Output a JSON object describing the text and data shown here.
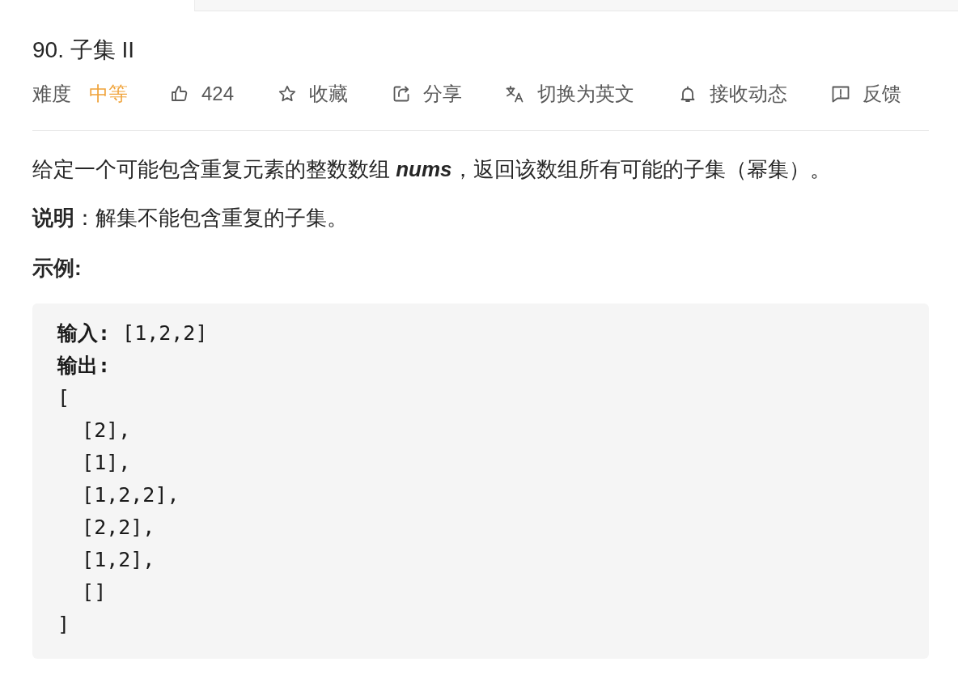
{
  "problem": {
    "title": "90. 子集 II",
    "difficulty": {
      "label": "难度",
      "value": "中等",
      "kind": "medium"
    },
    "actions": [
      {
        "kind": "like",
        "label": "424"
      },
      {
        "kind": "favorite",
        "label": "收藏"
      },
      {
        "kind": "share",
        "label": "分享"
      },
      {
        "kind": "translate",
        "label": "切换为英文"
      },
      {
        "kind": "subscribe",
        "label": "接收动态"
      },
      {
        "kind": "feedback",
        "label": "反馈"
      }
    ]
  },
  "description": [
    "给定一个可能包含重复元素的整数数组 **nums**，返回该数组所有可能的子集（幂集）。",
    "**说明**：解集不能包含重复的子集。"
  ],
  "example": {
    "heading": "示例:",
    "input": "**输入:** [1,2,2]",
    "output_label": "输出:",
    "output": {
      "open": "[",
      "items": [
        "[2],",
        "[1],",
        "[1,2,2],",
        "[2,2],",
        "[1,2],",
        "[]"
      ],
      "close": "]"
    }
  }
}
